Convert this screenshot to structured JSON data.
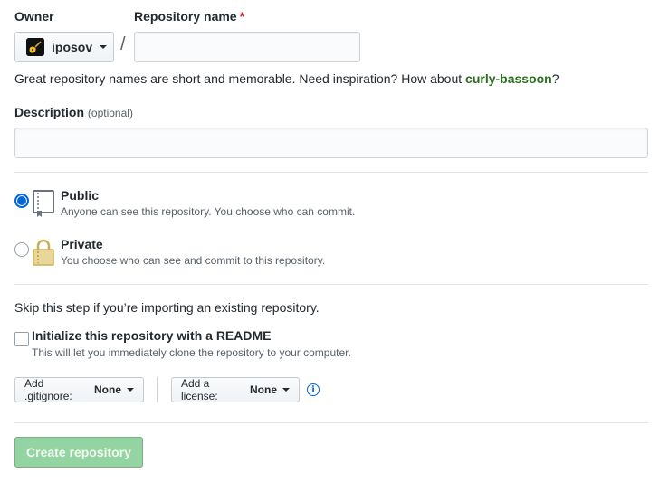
{
  "owner": {
    "label": "Owner",
    "value": "iposov"
  },
  "repository_name": {
    "label": "Repository name",
    "required_mark": "*",
    "value": "",
    "separator": "/"
  },
  "name_hint": {
    "text": "Great repository names are short and memorable. Need inspiration? How about ",
    "suggestion": "curly-bassoon",
    "suffix": "?"
  },
  "description": {
    "label": "Description",
    "optional": "(optional)",
    "value": ""
  },
  "visibility": {
    "public": {
      "title": "Public",
      "desc": "Anyone can see this repository. You choose who can commit.",
      "selected": true,
      "icon": "repo-icon"
    },
    "private": {
      "title": "Private",
      "desc": "You choose who can see and commit to this repository.",
      "selected": false,
      "icon": "lock-icon"
    }
  },
  "skip_note": "Skip this step if you’re importing an existing repository.",
  "readme": {
    "title": "Initialize this repository with a README",
    "desc": "This will let you immediately clone the repository to your computer.",
    "checked": false
  },
  "gitignore": {
    "label": "Add .gitignore:",
    "value": "None"
  },
  "license": {
    "label": "Add a license:",
    "value": "None"
  },
  "info_icon": "info-icon",
  "create_button": {
    "label": "Create repository",
    "disabled": true
  },
  "colors": {
    "primary": "#0366d6",
    "suggestion": "#2c6e1f",
    "button_disabled": "#94d3a2",
    "required": "#cb2431"
  }
}
